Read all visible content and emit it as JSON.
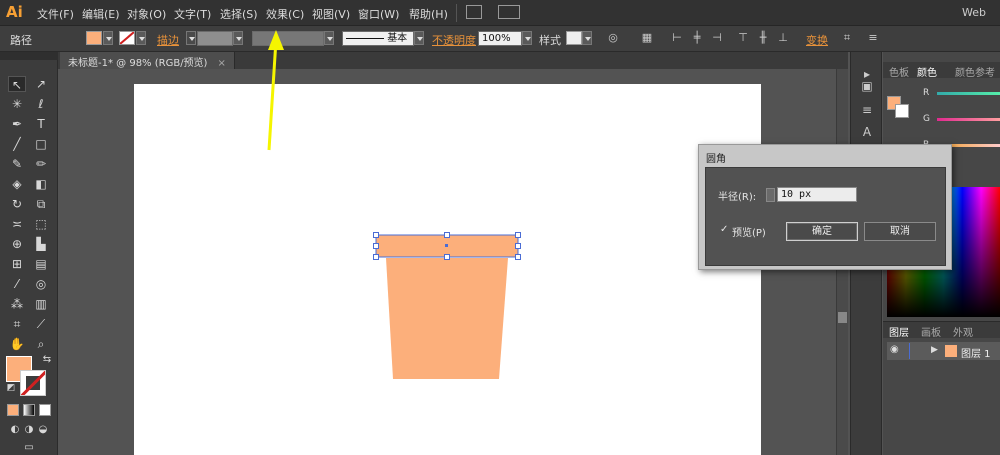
{
  "app": {
    "logo": "Ai",
    "workspace": "Web"
  },
  "menu": [
    "文件(F)",
    "编辑(E)",
    "对象(O)",
    "文字(T)",
    "选择(S)",
    "效果(C)",
    "视图(V)",
    "窗口(W)",
    "帮助(H)"
  ],
  "control_bar": {
    "path_label": "路径",
    "stroke_label": "描边",
    "stroke_profile": "基本",
    "opacity_label": "不透明度",
    "opacity_value": "100%",
    "style_label": "样式",
    "transform_label": "变换"
  },
  "document_tab": {
    "label": "未标题-1* @ 98% (RGB/预览)",
    "close": "×"
  },
  "panels": {
    "color_tabs": [
      "色板",
      "颜色",
      "颜色参考"
    ],
    "active_color_tab": "颜色",
    "channels": [
      "R",
      "G",
      "B"
    ],
    "layers_tabs": [
      "图层",
      "画板",
      "外观"
    ],
    "layer_name": "图层 1"
  },
  "dialog": {
    "title": "圆角",
    "radius_label": "半径(R):",
    "radius_value": "10 px",
    "preview_check": "✓",
    "preview_label": "预览(P)",
    "ok_label": "确定",
    "cancel_label": "取消"
  },
  "colors": {
    "fill": "#fcaf7b",
    "accent": "#f7a034",
    "selection": "#4a6cd4",
    "annotation_arrow": "#f5f500"
  }
}
